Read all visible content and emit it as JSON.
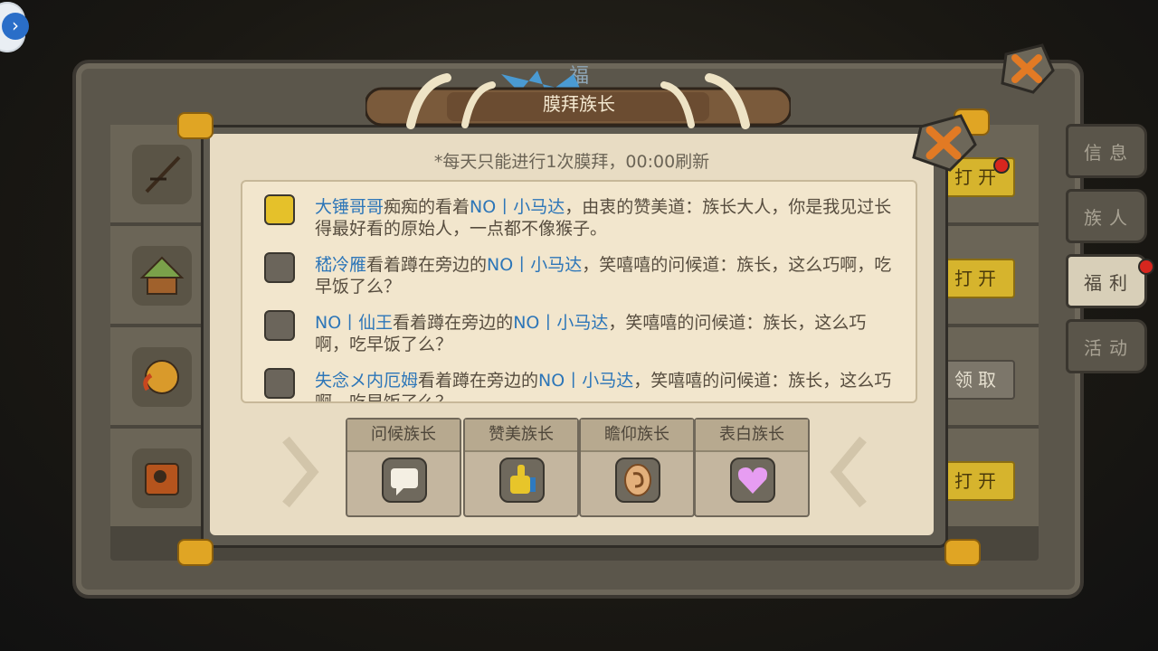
{
  "dialog": {
    "title": "膜拜族长",
    "notice": "*每天只能进行1次膜拜，00:00刷新"
  },
  "messages": [
    {
      "icon": "thumbs-up-icon",
      "name": "大锤哥哥",
      "verb1": "痴痴的看着",
      "target": "NO丨小马达",
      "text": "，由衷的赞美道：族长大人，你是我见过长得最好看的原始人，一点都不像猴子。"
    },
    {
      "icon": "chat-bubble-icon",
      "name": "嵇冷雁",
      "verb1": "看着蹲在旁边的",
      "target": "NO丨小马达",
      "text": "，笑嘻嘻的问候道：族长，这么巧啊，吃早饭了么？"
    },
    {
      "icon": "chat-bubble-icon",
      "name": "NO丨仙王",
      "verb1": "看着蹲在旁边的",
      "target": "NO丨小马达",
      "text": "，笑嘻嘻的问候道：族长，这么巧啊，吃早饭了么？"
    },
    {
      "icon": "chat-bubble-icon",
      "name": "失念メ内厄姆",
      "verb1": "看着蹲在旁边的",
      "target": "NO丨小马达",
      "text": "，笑嘻嘻的问候道：族长，这么巧啊，吃早饭了么？"
    }
  ],
  "actions": [
    {
      "label": "问候族长",
      "icon": "chat-bubble-icon"
    },
    {
      "label": "赞美族长",
      "icon": "thumbs-up-icon"
    },
    {
      "label": "瞻仰族长",
      "icon": "ear-icon"
    },
    {
      "label": "表白族长",
      "icon": "heart-icon"
    }
  ],
  "background_panel": {
    "title_partial": "福",
    "buttons": [
      "打开",
      "打开",
      "领取",
      "打开"
    ]
  },
  "side_tabs": [
    {
      "label": "信息",
      "active": false,
      "badge": false
    },
    {
      "label": "族人",
      "active": false,
      "badge": false
    },
    {
      "label": "福利",
      "active": true,
      "badge": true
    },
    {
      "label": "活动",
      "active": false,
      "badge": false
    }
  ],
  "colors": {
    "name_blue": "#2d76b8",
    "paper": "#e8dcc3",
    "button_gold": "#d6b42d",
    "badge_red": "#d7261e"
  }
}
